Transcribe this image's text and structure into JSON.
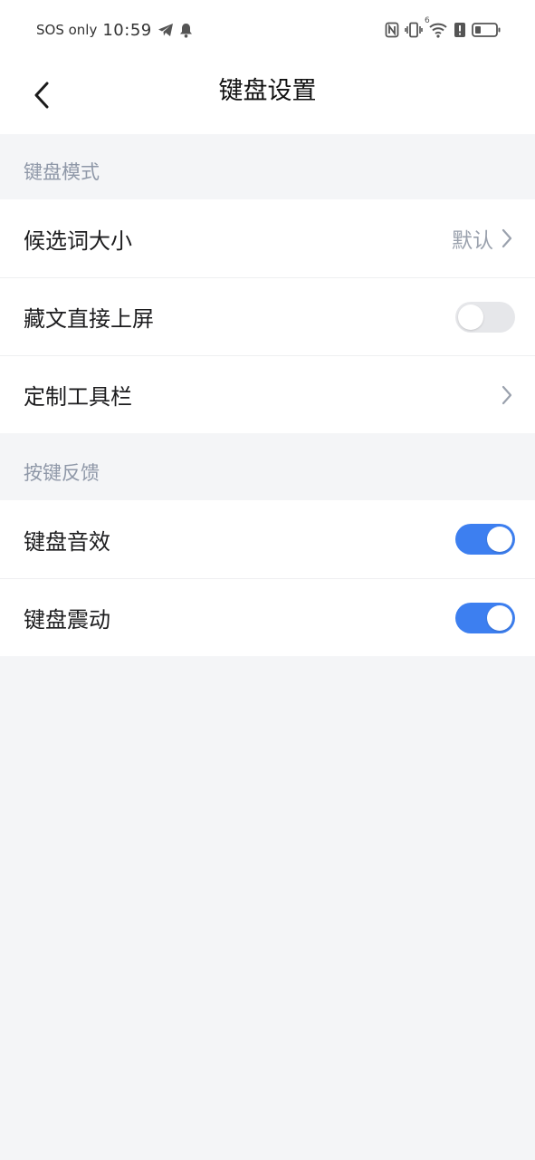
{
  "status_bar": {
    "carrier": "SOS only",
    "time": "10:59",
    "network_label": "6"
  },
  "header": {
    "title": "键盘设置"
  },
  "sections": [
    {
      "label": "键盘模式",
      "items": [
        {
          "label": "候选词大小",
          "value": "默认",
          "control": "chevron"
        },
        {
          "label": "藏文直接上屏",
          "control": "toggle",
          "checked": false
        },
        {
          "label": "定制工具栏",
          "control": "chevron"
        }
      ]
    },
    {
      "label": "按键反馈",
      "items": [
        {
          "label": "键盘音效",
          "control": "toggle",
          "checked": true
        },
        {
          "label": "键盘震动",
          "control": "toggle",
          "checked": true
        }
      ]
    }
  ],
  "colors": {
    "accent": "#3d7ff0",
    "toggle_off": "#e6e7ea",
    "page_background": "#f4f5f7",
    "section_label": "#8f98a8"
  }
}
